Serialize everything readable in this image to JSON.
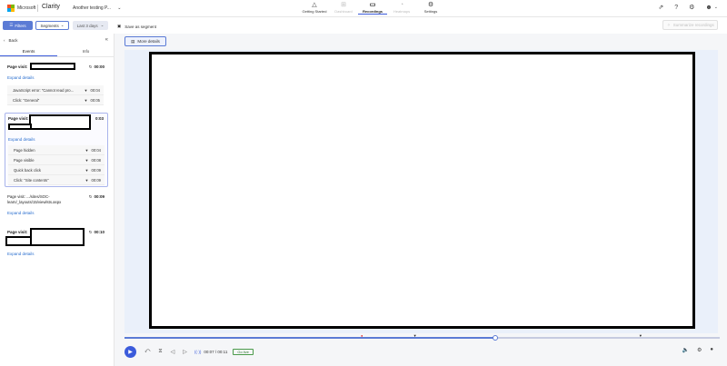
{
  "topbar": {
    "brand": "Microsoft",
    "app_name": "Clarity",
    "project": "Another testing P...",
    "project_chevron": "⌄",
    "nav": [
      {
        "label": "Getting Started",
        "icon": "△",
        "state": "on"
      },
      {
        "label": "Dashboard",
        "icon": "⊞",
        "state": "off"
      },
      {
        "label": "Recordings",
        "icon": "▭",
        "state": "active"
      },
      {
        "label": "Heatmaps",
        "icon": "◔",
        "state": "off"
      },
      {
        "label": "Settings",
        "icon": "⚙",
        "state": "on"
      }
    ],
    "icons": {
      "share": "⇗",
      "help": "?",
      "settings": "⚙",
      "avatar": "☻",
      "chevron": "⌄"
    }
  },
  "filterbar": {
    "filters_label": "Filters",
    "filters_icon": "☰",
    "segments_label": "Segments",
    "segments_chevron": "⌄",
    "days_label": "Last 3 days",
    "days_chevron": "⌄",
    "save_icon": "▣",
    "save_segment_label": "Save as segment",
    "summarize_icon": "✧",
    "summarize_label": "Summarize recordings"
  },
  "sidebar": {
    "back_icon": "‹",
    "back_label": "Back",
    "collapse_icon": "«",
    "tabs": [
      {
        "label": "Events"
      },
      {
        "label": "Info"
      }
    ],
    "cards": [
      {
        "title": "Page visit:",
        "refresh_icon": "↻",
        "time": "00:00",
        "expand_label": "Expand details",
        "events": [
          {
            "label": "JavaScript error: \"Cannot read pro...",
            "pin": "▼",
            "time": "00:04"
          },
          {
            "label": "Click: \"General\"",
            "pin": "▼",
            "time": "00:05"
          }
        ]
      },
      {
        "title": "Page visit:",
        "time": "0:03",
        "expand_label": "Expand details",
        "events": [
          {
            "label": "Page hidden",
            "pin": "▼",
            "time": "00:04"
          },
          {
            "label": "Page visible",
            "pin": "▼",
            "time": "00:08"
          },
          {
            "label": "Quick back click",
            "pin": "▼",
            "time": "00:09"
          },
          {
            "label": "Click: \"Site contents\"",
            "pin": "▼",
            "time": "00:09"
          }
        ]
      },
      {
        "url": "Page visit: .../sites/SOC-learn/_layouts/15/viewlsts.aspx",
        "refresh_icon": "↻",
        "time": "00:09",
        "expand_label": "Expand details"
      },
      {
        "title": "Page visit:",
        "refresh_icon": "↻",
        "time": "00:10",
        "expand_label": "Expand details"
      }
    ]
  },
  "main": {
    "more_details_icon": "▤",
    "more_details_label": "More details",
    "player": {
      "play_icon": "▶",
      "skip_icon": "⤺",
      "speed_icon": "⧖",
      "prev_icon": "◁",
      "next_icon": "▷",
      "wave_icon": "((·))",
      "time": "00:07 / 00:11",
      "progress": 0.623,
      "go_live_label": "Go live",
      "volume_icon": "🔈",
      "settings_icon": "⚙",
      "fullscreen_icon": "●",
      "markers": [
        {
          "color": "red",
          "symbol": "●",
          "at": 0.4
        },
        {
          "color": "black",
          "symbol": "▼",
          "at": 0.488
        },
        {
          "color": "black",
          "symbol": "▼",
          "at": 0.867
        }
      ]
    }
  }
}
